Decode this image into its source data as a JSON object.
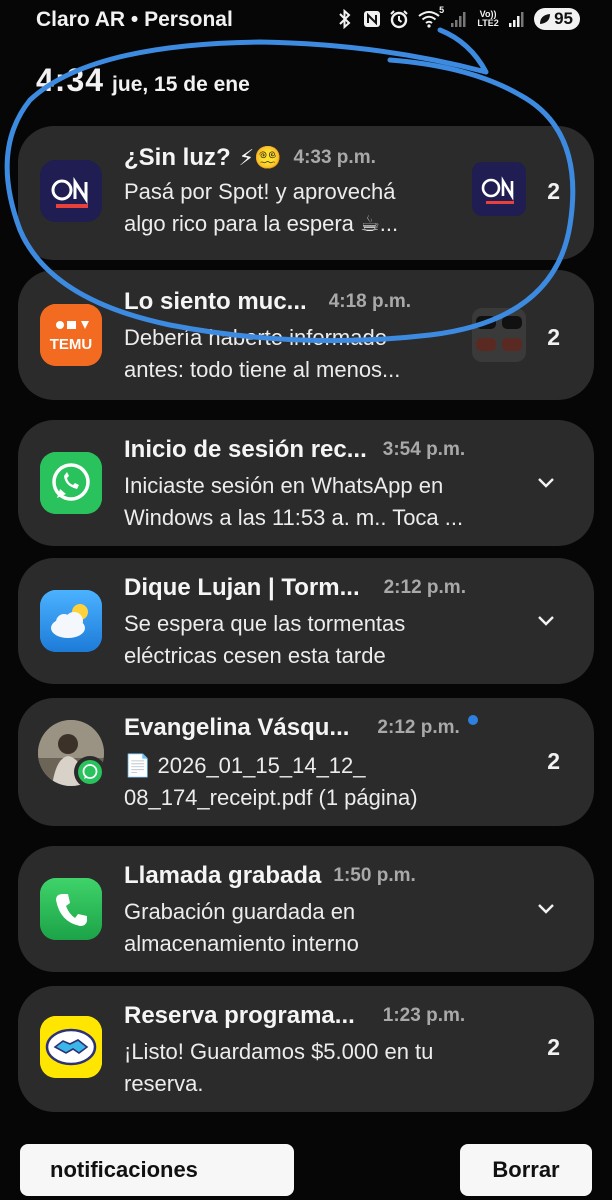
{
  "status_bar": {
    "carrier": "Claro AR • Personal",
    "wifi_badge": "5",
    "network_line1": "Vo))",
    "network_line2": "LTE2",
    "battery": "95",
    "icons": [
      "bluetooth-icon",
      "nfc-icon",
      "alarm-icon",
      "wifi-icon",
      "signal-icon",
      "battery-icon"
    ]
  },
  "lockscreen": {
    "clock": "4:34",
    "date": "jue, 15 de ene"
  },
  "notifications": [
    {
      "app": "ON Axion",
      "title": "¿Sin luz?",
      "title_emoji": "⚡😵‍💫",
      "time": "4:33 p.m.",
      "line1": "Pasá por Spot! y aprovechá",
      "line2": "algo rico para la espera ☕...",
      "count": "2",
      "icon": "axion-on-logo-icon",
      "thumbnail": "axion-on-logo-thumbnail"
    },
    {
      "app": "Temu",
      "title": "Lo siento muc...",
      "time": "4:18 p.m.",
      "line1": "Debería haberte informado",
      "line2": "antes: todo tiene al menos...",
      "count": "2",
      "icon": "temu-logo-icon",
      "thumbnail": "sunglasses-thumbnail"
    },
    {
      "app": "WhatsApp",
      "title": "Inicio de sesión rec...",
      "time": "3:54 p.m.",
      "line1": "Iniciaste sesión en WhatsApp en",
      "line2": "Windows a las 11:53 a. m.. Toca ...",
      "icon": "whatsapp-icon"
    },
    {
      "app": "Weather",
      "title": "Dique Lujan | Torm...",
      "time": "2:12 p.m.",
      "line1": "Se espera que las tormentas",
      "line2": "eléctricas cesen esta tarde",
      "icon": "weather-icon"
    },
    {
      "app": "WhatsApp",
      "title": "Evangelina Vásqu...",
      "time": "2:12 p.m.",
      "line1": "📄 2026_01_15_14_12_",
      "line2": "08_174_receipt.pdf (1 página)",
      "count": "2",
      "icon": "contact-avatar-icon"
    },
    {
      "app": "Phone",
      "title": "Llamada grabada",
      "time": "1:50 p.m.",
      "line1": "Grabación guardada en",
      "line2": "almacenamiento interno",
      "icon": "phone-icon"
    },
    {
      "app": "Mercado Pago",
      "title": "Reserva programa...",
      "time": "1:23 p.m.",
      "line1": "¡Listo! Guardamos $5.000 en tu",
      "line2": "reserva.",
      "count": "2",
      "icon": "mercado-handshake-icon"
    }
  ],
  "actions": {
    "settings_label": "notificaciones",
    "clear_label": "Borrar"
  },
  "annotation": {
    "color": "#3d8be0"
  }
}
